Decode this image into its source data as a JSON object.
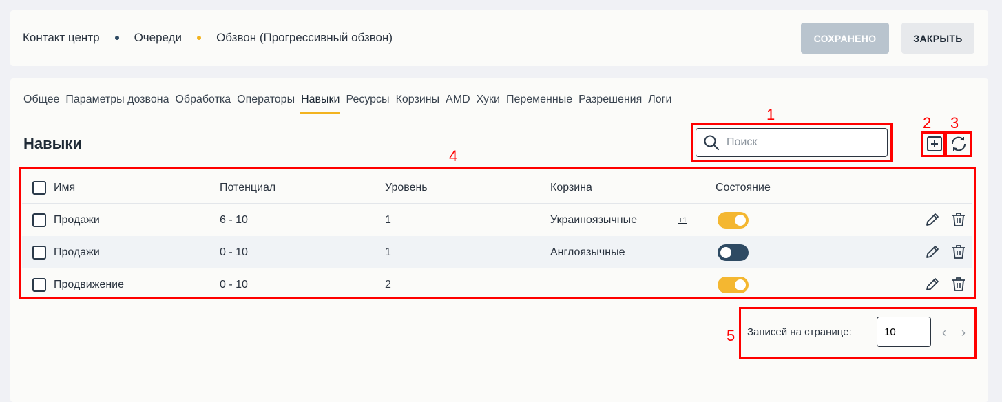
{
  "breadcrumb": {
    "items": [
      "Контакт центр",
      "Очереди",
      "Обзвон (Прогрессивный обзвон)"
    ],
    "dot_colors": [
      "#2e4a63",
      "#f2b31f"
    ]
  },
  "header_buttons": {
    "saved_label": "СОХРАНЕНО",
    "close_label": "ЗАКРЫТЬ"
  },
  "tabs": [
    {
      "label": "Общее"
    },
    {
      "label": "Параметры дозвона"
    },
    {
      "label": "Обработка"
    },
    {
      "label": "Операторы"
    },
    {
      "label": "Навыки",
      "active": true
    },
    {
      "label": "Ресурсы"
    },
    {
      "label": "Корзины"
    },
    {
      "label": "AMD"
    },
    {
      "label": "Хуки"
    },
    {
      "label": "Переменные"
    },
    {
      "label": "Разрешения"
    },
    {
      "label": "Логи"
    }
  ],
  "section_title": "Навыки",
  "search": {
    "placeholder": "Поиск",
    "icon": "search-icon"
  },
  "toolbar": {
    "add_icon": "plus-square-icon",
    "refresh_icon": "refresh-icon"
  },
  "table": {
    "columns": [
      "Имя",
      "Потенциал",
      "Уровень",
      "Корзина",
      "Состояние"
    ],
    "rows": [
      {
        "name": "Продажи",
        "potential": "6 - 10",
        "level": "1",
        "bucket": "Украиноязычные",
        "extra": "+1",
        "state": "on"
      },
      {
        "name": "Продажи",
        "potential": "0 - 10",
        "level": "1",
        "bucket": "Англоязычные",
        "extra": "",
        "state": "off"
      },
      {
        "name": "Продвижение",
        "potential": "0 - 10",
        "level": "2",
        "bucket": "",
        "extra": "",
        "state": "on"
      }
    ]
  },
  "pager": {
    "label": "Записей на странице:",
    "value": "10"
  },
  "annotations": [
    "1",
    "2",
    "3",
    "4",
    "5"
  ],
  "colors": {
    "accent": "#f2b31f",
    "toggle_on": "#f4b731",
    "toggle_off": "#2e4a63",
    "annotation": "#ff0000"
  }
}
